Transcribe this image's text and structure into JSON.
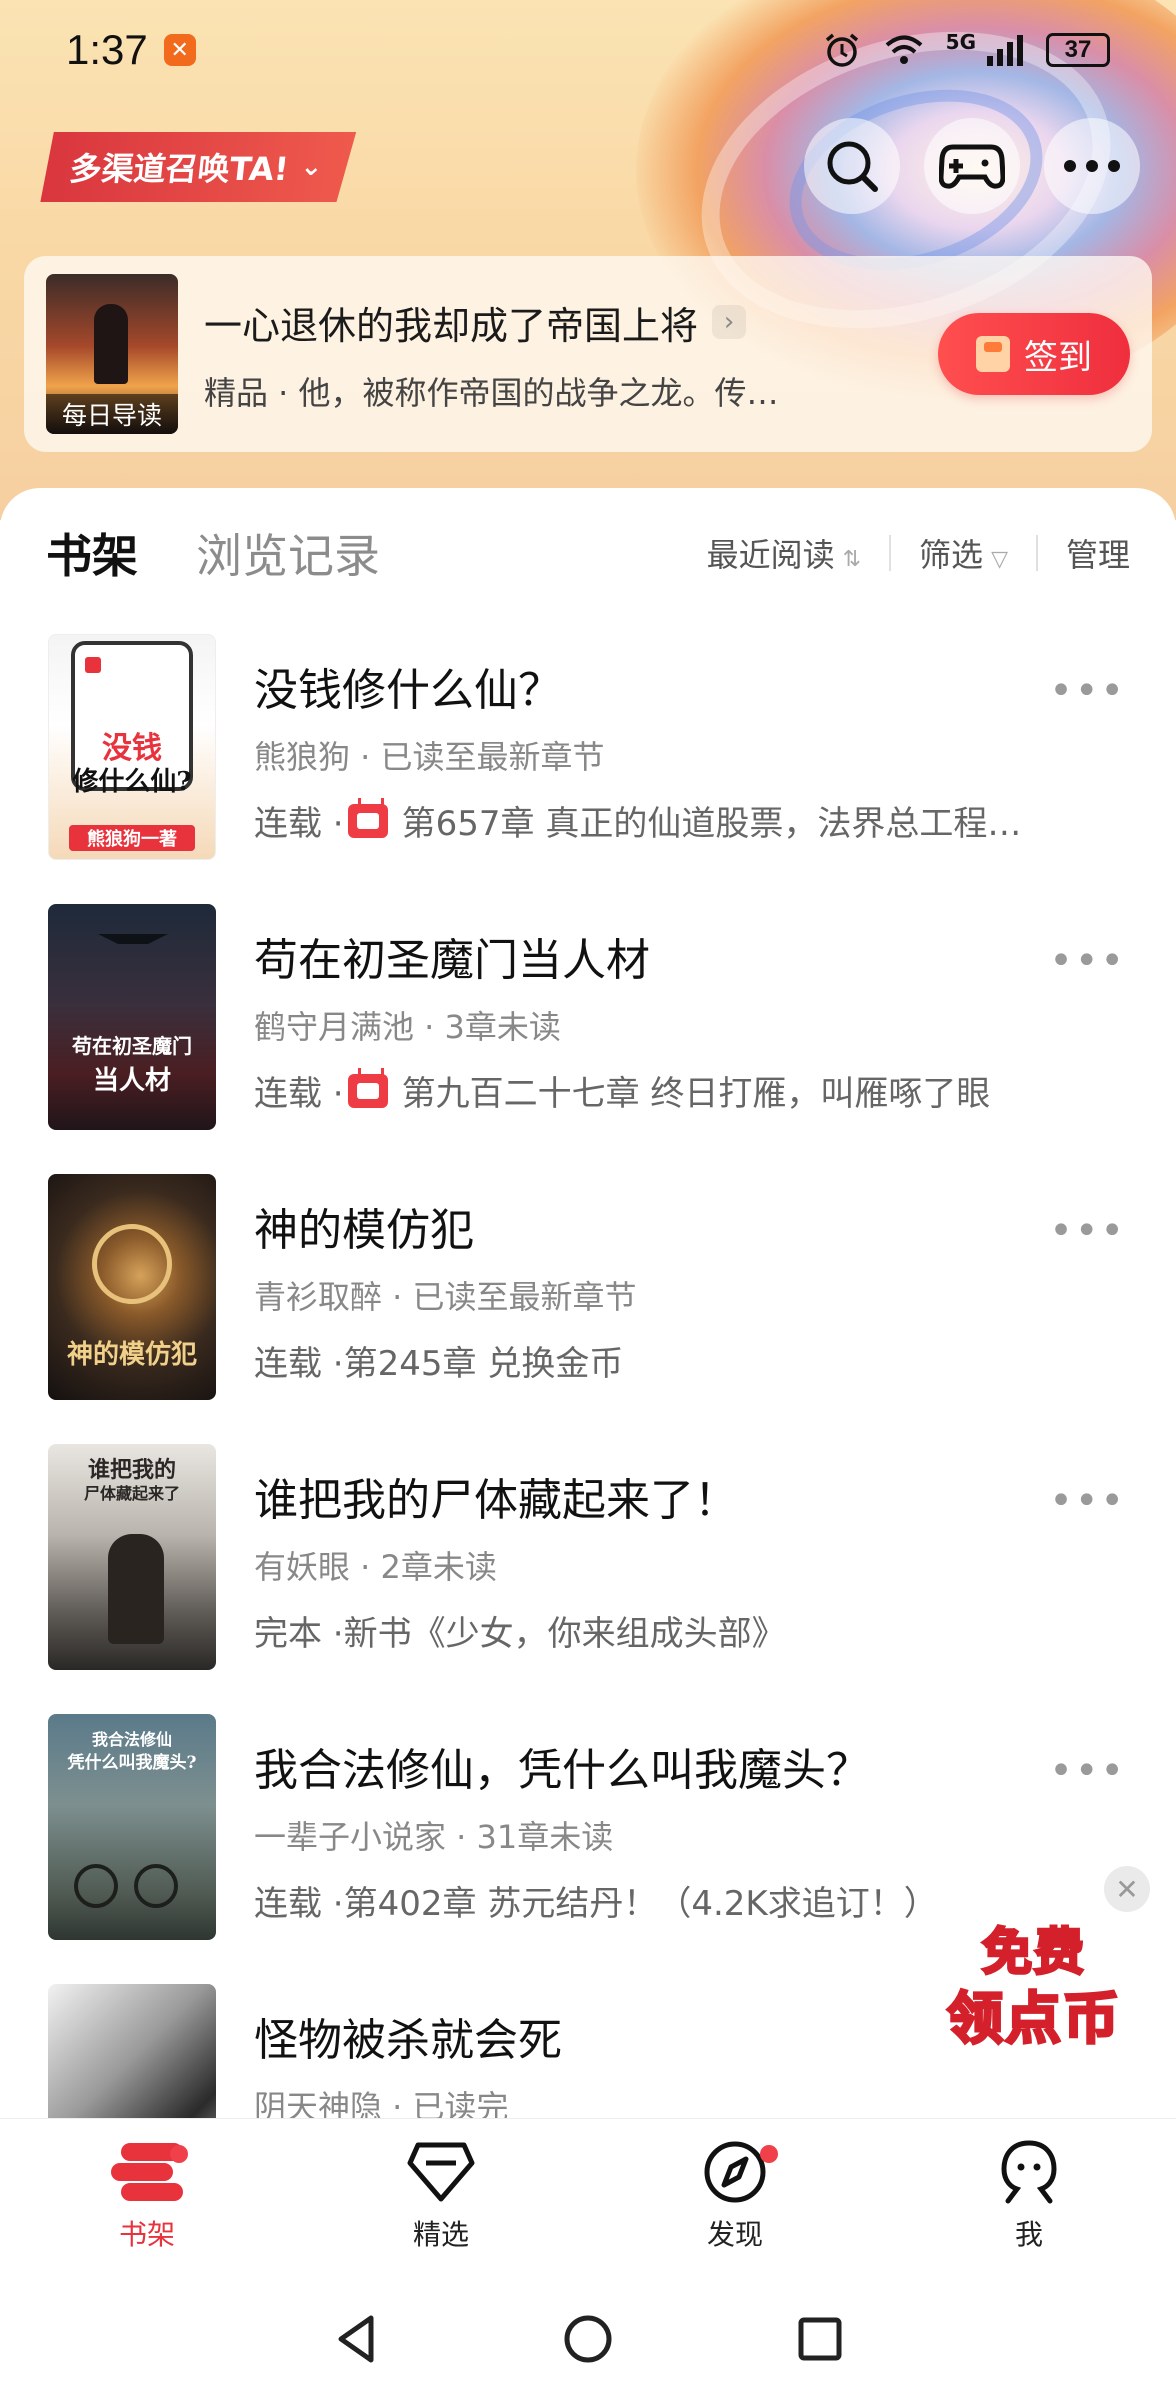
{
  "status_bar": {
    "time": "1:37",
    "network": "5G",
    "battery": "37"
  },
  "header": {
    "channel_banner": "多渠道召唤TA!",
    "icons": [
      "search-icon",
      "gamepad-icon",
      "more-icon"
    ]
  },
  "daily_pick": {
    "cover_label": "每日导读",
    "title": "一心退休的我却成了帝国上将",
    "description": "精品 · 他，被称作帝国的战争之龙。传…",
    "signin_label": "签到"
  },
  "shelf": {
    "tab_shelf": "书架",
    "tab_history": "浏览记录",
    "sort_label": "最近阅读",
    "filter_label": "筛选",
    "manage_label": "管理"
  },
  "books": [
    {
      "title": "没钱修什么仙？",
      "meta": "熊狼狗 · 已读至最新章节",
      "status": "连载 · ",
      "update": "第657章 真正的仙道股票，法界总工程…",
      "has_tv_icon": true,
      "cover_text": [
        "没钱",
        "修什么仙?",
        "熊狼狗一著"
      ]
    },
    {
      "title": "苟在初圣魔门当人材",
      "meta": "鹤守月满池 · 3章未读",
      "status": "连载 · ",
      "update": "第九百二十七章 终日打雁，叫雁啄了眼",
      "has_tv_icon": true,
      "cover_text": [
        "苟在初圣魔门",
        "当人材"
      ]
    },
    {
      "title": "神的模仿犯",
      "meta": "青衫取醉 · 已读至最新章节",
      "status": "连载 · ",
      "update": "第245章 兑换金币",
      "has_tv_icon": false,
      "cover_text": [
        "神的模仿犯"
      ]
    },
    {
      "title": "谁把我的尸体藏起来了！",
      "meta": "有妖眼 · 2章未读",
      "status": "完本 · ",
      "update": "新书《少女，你来组成头部》",
      "has_tv_icon": false,
      "cover_text": [
        "谁把我的",
        "尸体藏起来了"
      ]
    },
    {
      "title": "我合法修仙，凭什么叫我魔头？",
      "meta": "一辈子小说家 · 31章未读",
      "status": "连载 · ",
      "update": "第402章 苏元结丹！（4.2K求追订！）",
      "has_tv_icon": false,
      "cover_text": [
        "我合法修仙",
        "凭什么叫我魔头?"
      ]
    },
    {
      "title": "怪物被杀就会死",
      "meta": "阴天神隐 · 已读完",
      "status": "",
      "update": "",
      "has_tv_icon": false,
      "cover_text": []
    }
  ],
  "floating_badge": {
    "line1": "免费",
    "line2": "领点币"
  },
  "bottom_nav": [
    {
      "label": "书架",
      "icon": "bookshelf-icon",
      "active": true,
      "dot": true
    },
    {
      "label": "精选",
      "icon": "diamond-icon",
      "active": false,
      "dot": false
    },
    {
      "label": "发现",
      "icon": "compass-icon",
      "active": false,
      "dot": true
    },
    {
      "label": "我",
      "icon": "profile-icon",
      "active": false,
      "dot": false
    }
  ],
  "colors": {
    "accent": "#e8323c",
    "header_bg": "#fbe3b3"
  }
}
